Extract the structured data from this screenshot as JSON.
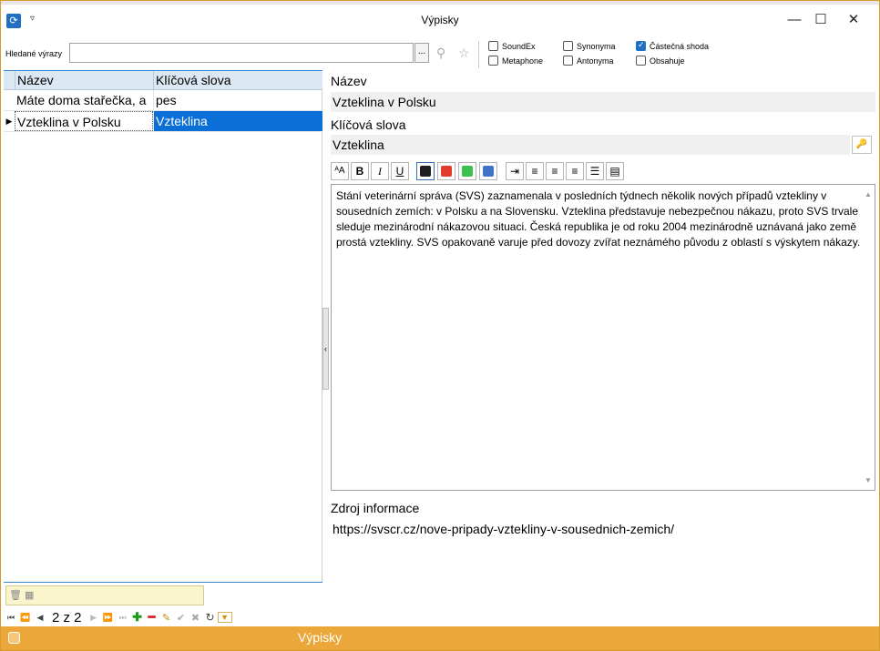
{
  "window": {
    "title": "Výpisky",
    "controls": {
      "minimize": "—",
      "maximize": "☐",
      "close": "✕"
    }
  },
  "search": {
    "label": "Hledané výrazy",
    "value": "",
    "browse_label": "...",
    "options": [
      {
        "label": "SoundEx",
        "checked": false
      },
      {
        "label": "Metaphone",
        "checked": false
      },
      {
        "label": "Synonyma",
        "checked": false
      },
      {
        "label": "Antonyma",
        "checked": false
      },
      {
        "label": "Částečná shoda",
        "checked": true
      },
      {
        "label": "Obsahuje",
        "checked": false
      }
    ]
  },
  "grid": {
    "columns": [
      "Název",
      "Klíčová slova"
    ],
    "rows": [
      {
        "name": "Máte doma stařečka, a",
        "keywords": "pes",
        "selected": false
      },
      {
        "name": "Vzteklina v Polsku",
        "keywords": "Vzteklina",
        "selected": true
      }
    ],
    "pager": "2 z 2"
  },
  "detail": {
    "name_label": "Název",
    "name_value": "Vzteklina v Polsku",
    "keywords_label": "Klíčová slova",
    "keywords_value": "Vzteklina",
    "text": "Stání veterinární správa (SVS) zaznamenala v posledních týdnech několik nových případů vztekliny v sousedních zemích: v Polsku a na Slovensku. Vzteklina představuje nebezpečnou nákazu, proto SVS trvale sleduje mezinárodní nákazovou situaci. Česká republika je od roku 2004 mezinárodně uznávaná jako země prostá vztekliny. SVS opakovaně varuje před dovozy zvířat neznámého původu z oblastí s výskytem nákazy.",
    "source_label": "Zdroj informace",
    "source_value": "https://svscr.cz/nove-pripady-vztekliny-v-sousednich-zemich/"
  },
  "toolbar_colors": [
    "#1f1f1f",
    "#e23b2e",
    "#3cc24e",
    "#3f74c7"
  ],
  "status": {
    "title": "Výpisky"
  },
  "accent": "#eca73b"
}
